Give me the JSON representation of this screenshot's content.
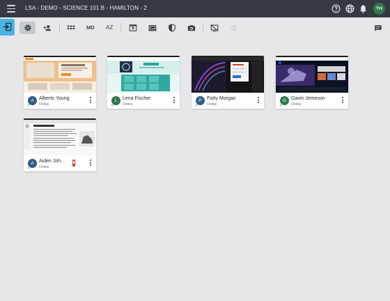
{
  "app": {
    "title": "LSA - DEMO - SCIENCE 101 B - HAMILTON - 2",
    "user_initials": "TH",
    "accent_color": "#4bb3e3",
    "avatar_color": "#2f7a4c"
  },
  "toolbar": {
    "md_label": "MD",
    "sort_label": "AZ"
  },
  "students": [
    {
      "name": "Alberto Young",
      "initial": "A",
      "status": "Online",
      "avatar_color": "#2f5b86",
      "alert": false,
      "thumb": "moodle-site"
    },
    {
      "name": "Lena Fischer",
      "initial": "L",
      "status": "Online",
      "avatar_color": "#2f7a4c",
      "alert": false,
      "thumb": "science-site"
    },
    {
      "name": "Patty Morgan",
      "initial": "P",
      "status": "Online",
      "avatar_color": "#2f5b86",
      "alert": false,
      "thumb": "login-dark"
    },
    {
      "name": "Gavin Jemeson",
      "initial": "G",
      "status": "Online",
      "avatar_color": "#2f7a4c",
      "alert": false,
      "thumb": "nasa-site"
    },
    {
      "name": "Aiden Joh...",
      "initial": "A",
      "status": "Online",
      "avatar_color": "#2f5b86",
      "alert": true,
      "thumb": "wiki-article"
    }
  ]
}
